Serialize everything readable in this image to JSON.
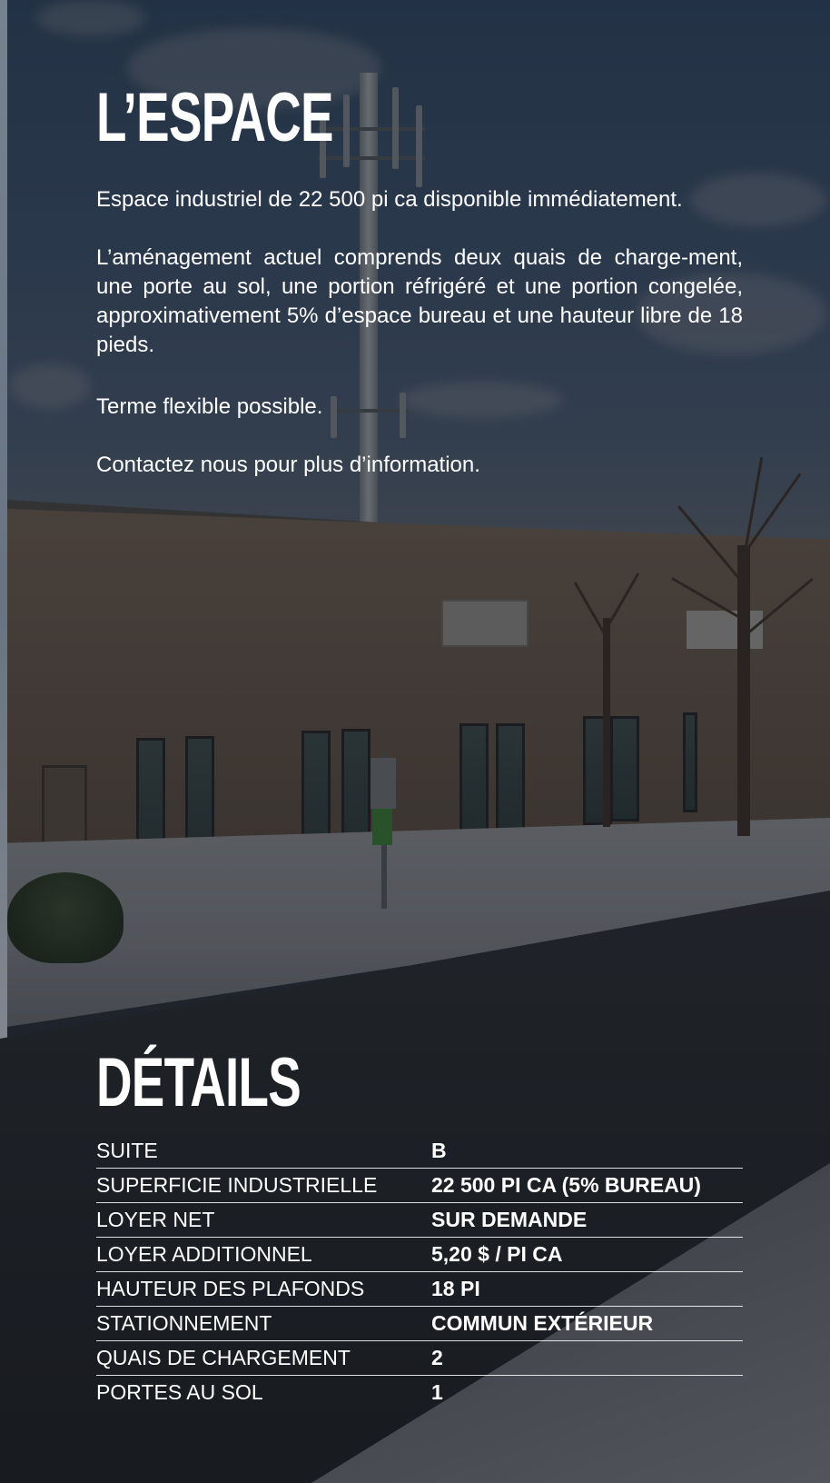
{
  "space_section": {
    "title": "L’ESPACE",
    "paragraphs": [
      "Espace industriel de 22 500 pi ca disponible immédiatement.",
      "L’aménagement actuel comprends deux quais de charge-ment, une porte au sol, une portion réfrigéré et une portion congelée, approximativement 5% d’espace bureau et une hauteur libre de 18 pieds.",
      "Terme flexible possible.",
      "Contactez nous pour plus d’information."
    ]
  },
  "details_section": {
    "title": "DÉTAILS",
    "rows": [
      {
        "label": "SUITE",
        "value": "B"
      },
      {
        "label": "SUPERFICIE INDUSTRIELLE",
        "value": "22 500 PI CA (5% BUREAU)"
      },
      {
        "label": "LOYER NET",
        "value": "SUR DEMANDE"
      },
      {
        "label": "LOYER ADDITIONNEL",
        "value": "5,20 $ / PI CA"
      },
      {
        "label": "HAUTEUR DES PLAFONDS",
        "value": "18 PI"
      },
      {
        "label": "STATIONNEMENT",
        "value": "COMMUN EXTÉRIEUR"
      },
      {
        "label": "QUAIS DE CHARGEMENT",
        "value": "2"
      },
      {
        "label": "PORTES AU SOL",
        "value": "1"
      }
    ]
  },
  "background": {
    "icon": "industrial-building-photo",
    "overlay_color": "#0c121c"
  }
}
